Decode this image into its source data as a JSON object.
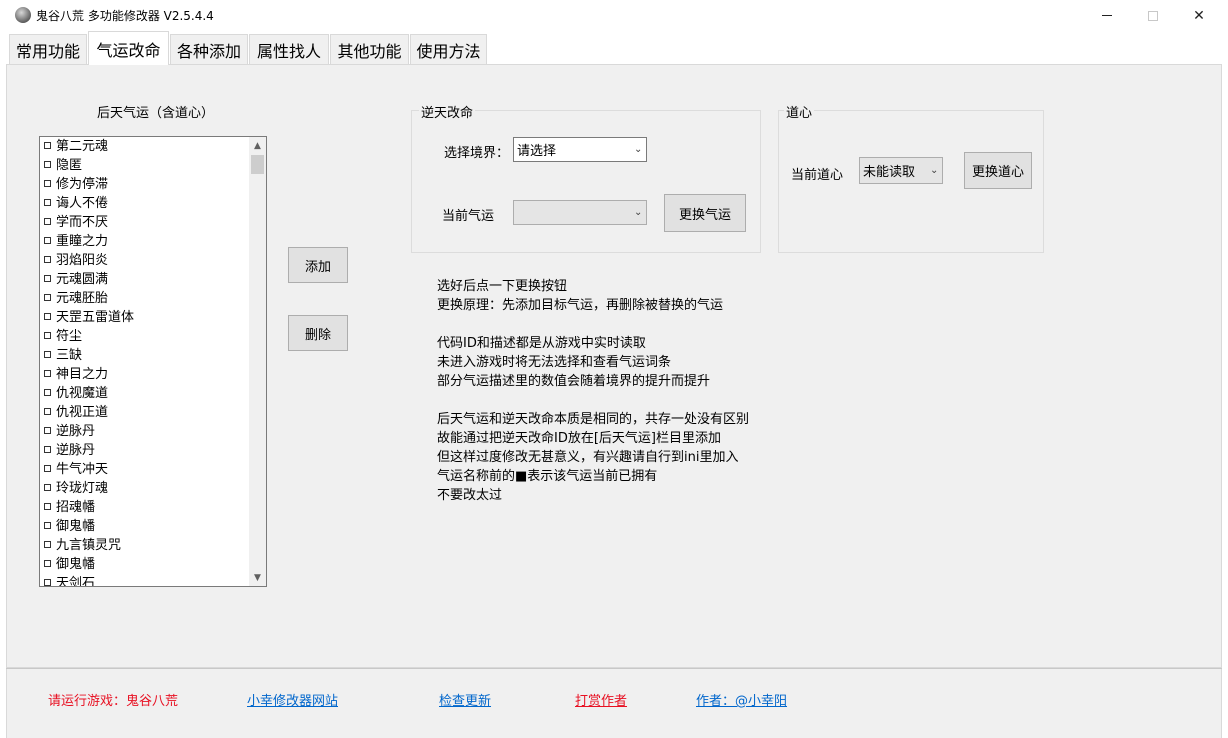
{
  "window": {
    "title": "鬼谷八荒 多功能修改器  V2.5.4.4",
    "min_icon": "minimize-icon",
    "max_icon": "maximize-icon",
    "close_symbol": "✕"
  },
  "tabs": [
    {
      "label": "常用功能",
      "active": false
    },
    {
      "label": "气运改命",
      "active": true
    },
    {
      "label": "各种添加",
      "active": false
    },
    {
      "label": "属性找人",
      "active": false
    },
    {
      "label": "其他功能",
      "active": false
    },
    {
      "label": "使用方法",
      "active": false
    }
  ],
  "left": {
    "title": "后天气运（含道心）",
    "items": [
      "第二元魂",
      "隐匿",
      "修为停滞",
      "诲人不倦",
      "学而不厌",
      "重瞳之力",
      "羽焰阳炎",
      "元魂圆满",
      "元魂胚胎",
      "天罡五雷道体",
      "符尘",
      "三缺",
      "神目之力",
      "仇视魔道",
      "仇视正道",
      "逆脉丹",
      "逆脉丹",
      "牛气冲天",
      "玲珑灯魂",
      "招魂幡",
      "御鬼幡",
      "九言镇灵咒",
      "御鬼幡",
      "天剑石"
    ],
    "add_button": "添加",
    "delete_button": "删除"
  },
  "fate": {
    "group_title": "逆天改命",
    "realm_label": "选择境界：",
    "realm_value": "请选择",
    "current_label": "当前气运",
    "current_value": "",
    "replace_button": "更换气运"
  },
  "daoxin": {
    "group_title": "道心",
    "current_label": "当前道心",
    "current_value": "未能读取",
    "replace_button": "更换道心"
  },
  "info_lines": [
    "选好后点一下更换按钮",
    "更换原理：先添加目标气运，再删除被替换的气运",
    "",
    "代码ID和描述都是从游戏中实时读取",
    "未进入游戏时将无法选择和查看气运词条",
    "部分气运描述里的数值会随着境界的提升而提升",
    "",
    "后天气运和逆天改命本质是相同的，共存一处没有区别",
    "故能通过把逆天改命ID放在[后天气运]栏目里添加",
    "但这样过度修改无甚意义，有兴趣请自行到ini里加入",
    "气运名称前的■表示该气运当前已拥有",
    "不要改太过"
  ],
  "footer": {
    "game_label": "请运行游戏：鬼谷八荒",
    "site_link": "小幸修改器网站",
    "update_link": "检查更新",
    "donate_link": "打赏作者",
    "author_link": "作者：@小幸阳"
  },
  "colors": {
    "red": "#e81123",
    "link_blue": "#0066cc",
    "panel_bg": "#f0f0f0"
  }
}
